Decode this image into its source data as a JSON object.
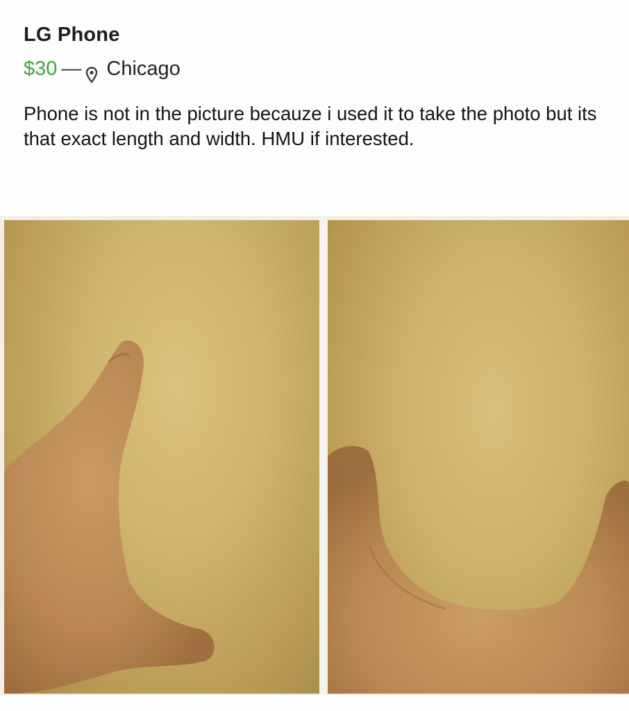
{
  "listing": {
    "title": "LG Phone",
    "price": "$30",
    "separator": "—",
    "location": "Chicago",
    "description": "Phone is not in the picture becauze i used it to take the photo but its that exact length and width. HMU if interested."
  },
  "icons": {
    "location": "map-pin-icon"
  },
  "colors": {
    "price": "#42a53f",
    "text": "#141414",
    "photo_background": "#cfb66e"
  }
}
